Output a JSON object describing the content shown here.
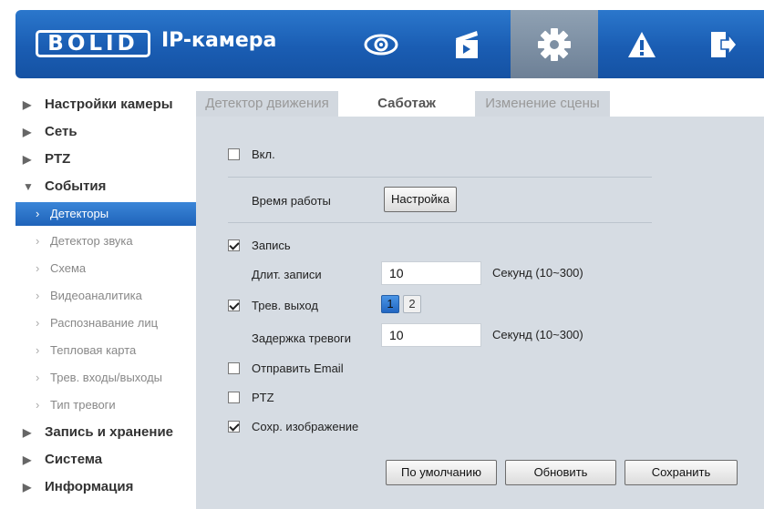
{
  "header": {
    "logo_text": "BOLID",
    "title": "IP-камера",
    "icons": [
      "eye-icon",
      "clapperboard-icon",
      "gear-icon",
      "warning-icon",
      "logout-icon"
    ],
    "active_icon": "gear-icon"
  },
  "sidebar": {
    "items": [
      {
        "label": "Настройки камеры"
      },
      {
        "label": "Сеть"
      },
      {
        "label": "PTZ"
      },
      {
        "label": "События"
      },
      {
        "label": "Детекторы"
      },
      {
        "label": "Детектор звука"
      },
      {
        "label": "Схема"
      },
      {
        "label": "Видеоаналитика"
      },
      {
        "label": "Распознавание лиц"
      },
      {
        "label": "Тепловая карта"
      },
      {
        "label": "Трев. входы/выходы"
      },
      {
        "label": "Тип тревоги"
      },
      {
        "label": "Запись и хранение"
      },
      {
        "label": "Система"
      },
      {
        "label": "Информация"
      }
    ],
    "arrow_closed": "▶",
    "arrow_open": "▼",
    "chevron": "›"
  },
  "tabs": [
    {
      "label": "Детектор движения"
    },
    {
      "label": "Саботаж"
    },
    {
      "label": "Изменение сцены"
    }
  ],
  "form": {
    "enable_label": "Вкл.",
    "enable_checked": false,
    "schedule_label": "Время работы",
    "schedule_button": "Настройка",
    "record_label": "Запись",
    "record_checked": true,
    "record_duration_label": "Длит. записи",
    "record_duration_value": "10",
    "record_duration_unit": "Секунд (10~300)",
    "alarm_out_label": "Трев. выход",
    "alarm_out_checked": true,
    "alarm_channels": [
      "1",
      "2"
    ],
    "alarm_channel_selected": "1",
    "alarm_delay_label": "Задержка тревоги",
    "alarm_delay_value": "10",
    "alarm_delay_unit": "Секунд (10~300)",
    "email_label": "Отправить Email",
    "email_checked": false,
    "ptz_label": "PTZ",
    "ptz_checked": false,
    "snapshot_label": "Сохр. изображение",
    "snapshot_checked": true
  },
  "buttons": {
    "default": "По умолчанию",
    "refresh": "Обновить",
    "save": "Сохранить"
  },
  "colors": {
    "header_blue": "#1a5db3",
    "active_blue": "#2a74cc",
    "panel_bg": "#d6dce3"
  }
}
